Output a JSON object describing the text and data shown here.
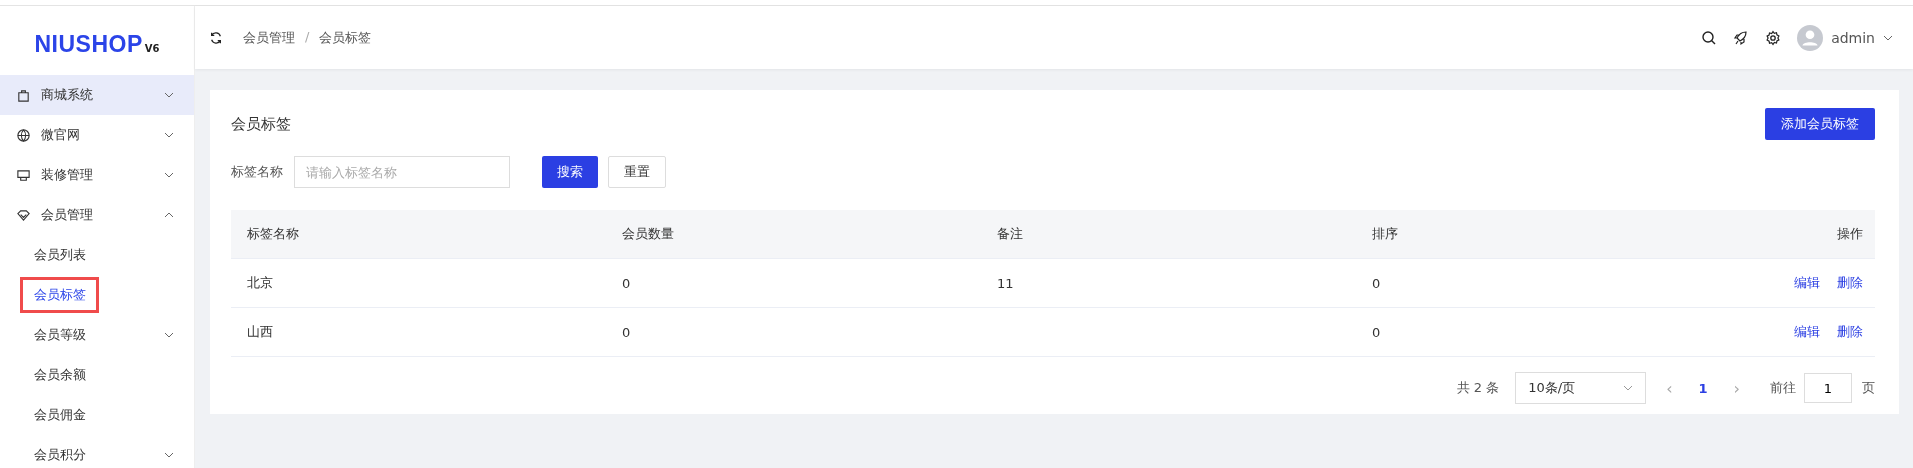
{
  "logo": {
    "text": "NIUSHOP",
    "version": "V6"
  },
  "sidebar": {
    "items": [
      {
        "label": "商城系统",
        "expanded": false,
        "highlighted": true
      },
      {
        "label": "微官网",
        "expanded": false,
        "highlighted": false
      },
      {
        "label": "装修管理",
        "expanded": false,
        "highlighted": false
      },
      {
        "label": "会员管理",
        "expanded": true,
        "highlighted": false,
        "children": [
          {
            "label": "会员列表",
            "selected": false,
            "annotated": false,
            "has_children": false
          },
          {
            "label": "会员标签",
            "selected": true,
            "annotated": true,
            "has_children": false
          },
          {
            "label": "会员等级",
            "selected": false,
            "annotated": false,
            "has_children": true
          },
          {
            "label": "会员余额",
            "selected": false,
            "annotated": false,
            "has_children": false
          },
          {
            "label": "会员佣金",
            "selected": false,
            "annotated": false,
            "has_children": false
          },
          {
            "label": "会员积分",
            "selected": false,
            "annotated": false,
            "has_children": true
          }
        ]
      }
    ]
  },
  "header": {
    "breadcrumb": [
      "会员管理",
      "会员标签"
    ],
    "separator": "/",
    "user": "admin"
  },
  "card": {
    "title": "会员标签",
    "add_button": "添加会员标签",
    "filter": {
      "label": "标签名称",
      "placeholder": "请输入标签名称",
      "search_button": "搜索",
      "reset_button": "重置"
    },
    "table": {
      "columns": [
        "标签名称",
        "会员数量",
        "备注",
        "排序",
        "操作"
      ],
      "rows": [
        {
          "cells": [
            "北京",
            "0",
            "11",
            "0"
          ],
          "actions": [
            "编辑",
            "删除"
          ]
        },
        {
          "cells": [
            "山西",
            "0",
            "",
            "0"
          ],
          "actions": [
            "编辑",
            "删除"
          ]
        }
      ]
    },
    "pagination": {
      "total": "共 2 条",
      "page_size": "10条/页",
      "prev": "‹",
      "next": "›",
      "pages": [
        {
          "label": "1",
          "selected": true
        }
      ],
      "goto_label": "前往",
      "goto_value": "1",
      "goto_suffix": "页"
    }
  }
}
